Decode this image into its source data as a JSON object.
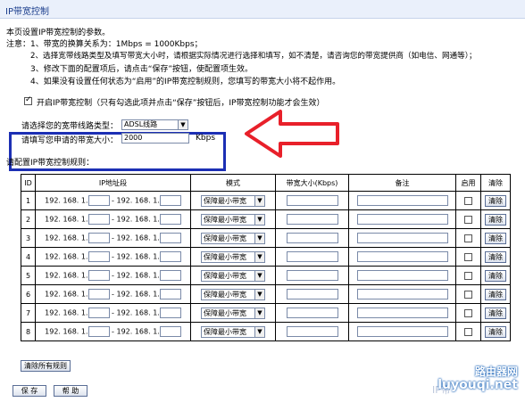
{
  "page": {
    "title": "IP带宽控制",
    "intro": "本页设置IP带宽控制的参数。",
    "note_label": "注意：",
    "notes": [
      "1、带宽的换算关系为：1Mbps = 1000Kbps；",
      "2、选择宽带线路类型及填写带宽大小时，请根据实际情况进行选择和填写，如不清楚，请咨询您的带宽提供商（如电信、网通等）；",
      "3、修改下面的配置项后，请点击“保存”按钮，使配置项生效。",
      "4、如果没有设置任何状态为“启用”的IP带宽控制规则，您填写的带宽大小将不起作用。"
    ],
    "enable_label": "开启IP带宽控制（只有勾选此项并点击“保存”按钮后，IP带宽控制功能才会生效）",
    "enable_checked": true
  },
  "line_settings": {
    "type_label": "请选择您的宽带线路类型：",
    "type_value": "ADSL线路",
    "bw_label": "请填写您申请的带宽大小：",
    "bw_value": "2000",
    "bw_unit": "Kbps",
    "highlight_color": "#1c2fb4",
    "arrow_color": "#e8202a"
  },
  "rules": {
    "title": "请配置IP带宽控制规则：",
    "headers": [
      "ID",
      "IP地址段",
      "模式",
      "带宽大小(Kbps)",
      "备注",
      "启用",
      "清除"
    ],
    "ip_prefix": "192. 168. 1.",
    "ip_separator": "-",
    "mode_value": "保障最小带宽",
    "clear_label": "清除",
    "rows": [
      {
        "id": "1"
      },
      {
        "id": "2"
      },
      {
        "id": "3"
      },
      {
        "id": "4"
      },
      {
        "id": "5"
      },
      {
        "id": "6"
      },
      {
        "id": "7"
      },
      {
        "id": "8"
      }
    ]
  },
  "footer": {
    "clear_all_label": "清除所有规则",
    "save_label": "保 存",
    "help_label": "帮 助"
  },
  "watermark": {
    "line1": "路由器网",
    "line2": "luyouqi.net",
    "faded": "IP带"
  }
}
